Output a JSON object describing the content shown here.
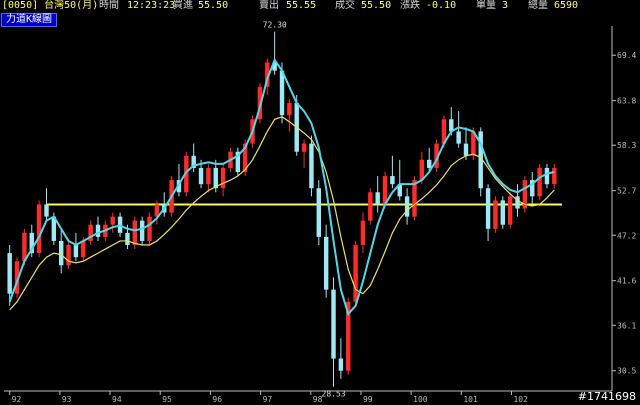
{
  "header": {
    "symbol": "[0050] 台灣50(月)",
    "time_label": "時間",
    "time": "12:23:23",
    "buy_label": "買進",
    "buy": "55.50",
    "sell_label": "賣出",
    "sell": "55.55",
    "deal_label": "成交",
    "deal": "55.50",
    "change_label": "漲跌",
    "change": "-0.10",
    "unit_label": "單量",
    "unit": "3",
    "total_label": "總量",
    "total": "6590"
  },
  "chart_tag": "力道K線圖",
  "watermark": "#1741698",
  "colors": {
    "up": "#ff2a2a",
    "down": "#9fe8f5",
    "ma_fast": "#4fd8e8",
    "ma_slow": "#f0e060",
    "hline": "#ffff40",
    "axis": "#bbbbbb",
    "header_value": "#ffff66"
  },
  "chart_data": {
    "type": "candlestick",
    "x_ticks": [
      "92",
      "93",
      "94",
      "95",
      "96",
      "97",
      "98",
      "99",
      "100",
      "101",
      "102"
    ],
    "y_ticks": [
      "30.5",
      "36.1",
      "41.6",
      "47.2",
      "52.7",
      "58.3",
      "63.8",
      "69.4"
    ],
    "ylim": [
      28.0,
      73.0
    ],
    "annotations": [
      {
        "text": "72.30",
        "value": 72.3
      },
      {
        "text": "28.53",
        "value": 28.53
      }
    ],
    "reference_line": 51.0,
    "candles": [
      [
        45.0,
        46.0,
        38.5,
        40.0
      ],
      [
        40.0,
        44.5,
        39.5,
        44.0
      ],
      [
        44.0,
        48.0,
        43.5,
        47.5
      ],
      [
        47.5,
        48.5,
        44.5,
        45.0
      ],
      [
        45.0,
        51.5,
        44.5,
        51.0
      ],
      [
        51.0,
        53.0,
        49.0,
        49.5
      ],
      [
        49.5,
        50.0,
        46.0,
        46.5
      ],
      [
        46.5,
        48.0,
        42.5,
        43.5
      ],
      [
        43.5,
        46.5,
        43.0,
        46.0
      ],
      [
        46.0,
        47.5,
        44.0,
        44.5
      ],
      [
        44.5,
        47.0,
        44.0,
        46.5
      ],
      [
        46.5,
        49.0,
        46.0,
        48.5
      ],
      [
        48.5,
        49.5,
        46.5,
        47.0
      ],
      [
        47.0,
        49.0,
        46.5,
        48.5
      ],
      [
        48.5,
        50.0,
        47.5,
        49.5
      ],
      [
        49.5,
        50.0,
        47.0,
        47.5
      ],
      [
        47.5,
        48.5,
        45.5,
        46.0
      ],
      [
        46.0,
        49.5,
        45.5,
        49.0
      ],
      [
        49.0,
        49.5,
        46.0,
        46.5
      ],
      [
        46.5,
        50.0,
        46.0,
        49.5
      ],
      [
        49.5,
        51.5,
        48.5,
        51.0
      ],
      [
        51.0,
        52.5,
        49.5,
        50.0
      ],
      [
        50.0,
        54.5,
        49.5,
        54.0
      ],
      [
        54.0,
        56.0,
        52.0,
        52.5
      ],
      [
        52.5,
        57.5,
        52.0,
        57.0
      ],
      [
        57.0,
        58.5,
        55.0,
        55.5
      ],
      [
        55.5,
        56.5,
        53.0,
        53.5
      ],
      [
        53.5,
        56.0,
        52.5,
        55.5
      ],
      [
        55.5,
        56.5,
        52.5,
        53.0
      ],
      [
        53.0,
        56.0,
        52.0,
        55.5
      ],
      [
        55.5,
        58.0,
        55.0,
        57.5
      ],
      [
        57.5,
        58.0,
        54.5,
        55.0
      ],
      [
        55.0,
        59.0,
        54.5,
        58.5
      ],
      [
        58.5,
        62.0,
        58.0,
        61.5
      ],
      [
        61.5,
        66.0,
        61.0,
        65.5
      ],
      [
        65.5,
        69.0,
        64.5,
        68.5
      ],
      [
        68.5,
        72.3,
        67.0,
        67.5
      ],
      [
        67.5,
        68.5,
        61.0,
        62.0
      ],
      [
        62.0,
        64.0,
        60.0,
        63.5
      ],
      [
        63.5,
        64.5,
        57.0,
        57.5
      ],
      [
        57.5,
        59.0,
        55.5,
        58.5
      ],
      [
        58.5,
        59.5,
        52.0,
        53.0
      ],
      [
        53.0,
        54.0,
        46.0,
        47.0
      ],
      [
        47.0,
        48.5,
        39.5,
        40.5
      ],
      [
        40.5,
        42.0,
        28.53,
        32.0
      ],
      [
        32.0,
        34.5,
        29.5,
        30.5
      ],
      [
        30.5,
        39.5,
        30.0,
        39.0
      ],
      [
        39.0,
        46.5,
        38.5,
        46.0
      ],
      [
        46.0,
        50.0,
        45.0,
        49.0
      ],
      [
        49.0,
        53.0,
        48.5,
        52.5
      ],
      [
        52.5,
        54.5,
        50.0,
        51.0
      ],
      [
        51.0,
        55.0,
        50.5,
        54.5
      ],
      [
        54.5,
        57.0,
        53.0,
        53.5
      ],
      [
        53.5,
        56.5,
        51.5,
        52.0
      ],
      [
        52.0,
        53.0,
        48.5,
        49.5
      ],
      [
        49.5,
        54.5,
        49.0,
        54.0
      ],
      [
        54.0,
        57.5,
        53.5,
        56.5
      ],
      [
        56.5,
        58.0,
        55.0,
        55.5
      ],
      [
        55.5,
        59.0,
        55.0,
        58.5
      ],
      [
        58.5,
        62.0,
        58.0,
        61.5
      ],
      [
        61.5,
        63.0,
        59.5,
        60.0
      ],
      [
        60.0,
        62.5,
        58.0,
        58.5
      ],
      [
        58.5,
        60.5,
        56.5,
        57.0
      ],
      [
        57.0,
        60.5,
        56.5,
        60.0
      ],
      [
        60.0,
        60.5,
        52.0,
        53.0
      ],
      [
        53.0,
        53.5,
        46.5,
        48.0
      ],
      [
        48.0,
        52.0,
        47.5,
        51.5
      ],
      [
        51.5,
        52.0,
        48.0,
        48.5
      ],
      [
        48.5,
        52.5,
        48.0,
        52.0
      ],
      [
        52.0,
        53.5,
        49.5,
        50.5
      ],
      [
        50.5,
        54.5,
        50.0,
        54.0
      ],
      [
        54.0,
        55.0,
        51.0,
        52.0
      ],
      [
        52.0,
        56.0,
        51.5,
        55.5
      ],
      [
        55.5,
        56.0,
        53.0,
        53.5
      ],
      [
        53.5,
        56.0,
        53.0,
        55.5
      ]
    ],
    "ma_fast": [
      39.0,
      41.5,
      44.0,
      45.5,
      47.0,
      49.0,
      49.5,
      48.0,
      46.5,
      46.0,
      46.5,
      47.0,
      47.5,
      47.8,
      48.2,
      48.4,
      48.0,
      47.8,
      48.0,
      48.5,
      49.3,
      50.5,
      52.0,
      53.5,
      55.0,
      55.8,
      56.0,
      56.2,
      56.0,
      56.0,
      56.5,
      57.0,
      58.0,
      60.0,
      63.0,
      66.5,
      68.8,
      67.5,
      65.5,
      63.5,
      62.5,
      61.0,
      58.0,
      53.0,
      46.5,
      40.5,
      37.5,
      38.5,
      41.5,
      45.0,
      48.5,
      51.0,
      52.5,
      53.5,
      53.5,
      53.5,
      54.0,
      55.0,
      56.5,
      58.5,
      60.0,
      60.5,
      60.3,
      60.0,
      58.5,
      56.0,
      54.5,
      53.5,
      52.8,
      52.5,
      53.0,
      53.5,
      54.3,
      54.8,
      55.0
    ],
    "ma_slow": [
      38.0,
      39.0,
      40.5,
      42.0,
      43.5,
      44.5,
      45.0,
      44.8,
      44.0,
      43.8,
      44.0,
      44.5,
      45.0,
      45.5,
      46.0,
      46.5,
      46.5,
      46.2,
      46.0,
      46.0,
      46.5,
      47.3,
      48.2,
      49.2,
      50.3,
      51.2,
      52.0,
      52.7,
      53.2,
      53.6,
      54.0,
      54.5,
      55.3,
      56.5,
      58.2,
      60.0,
      61.5,
      61.8,
      61.2,
      60.5,
      59.8,
      59.0,
      57.5,
      55.0,
      51.5,
      47.0,
      43.0,
      40.5,
      40.0,
      41.0,
      43.0,
      45.2,
      47.5,
      49.2,
      50.3,
      51.0,
      51.7,
      52.5,
      53.4,
      54.5,
      55.8,
      56.5,
      57.0,
      57.2,
      56.8,
      55.5,
      54.2,
      53.2,
      52.3,
      51.5,
      51.0,
      50.8,
      51.0,
      51.8,
      52.8
    ]
  }
}
